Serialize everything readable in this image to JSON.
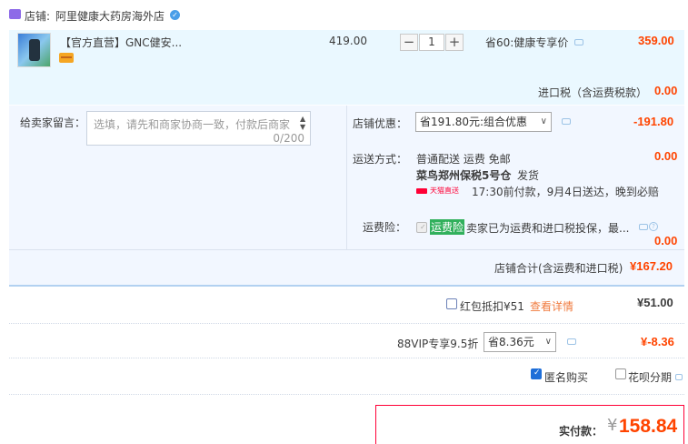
{
  "shop": {
    "prefix": "店铺:",
    "name": "阿里健康大药房海外店"
  },
  "item": {
    "title": "【官方直营】GNC健安...",
    "unit_price": "419.00",
    "quantity": "1",
    "qty_minus": "−",
    "qty_plus": "+",
    "promo": "省60:健康专享价",
    "subtotal": "359.00"
  },
  "tax": {
    "label": "进口税（含运费税款）",
    "value": "0.00"
  },
  "message": {
    "label": "给卖家留言：",
    "placeholder": "选填，请先和商家协商一致，付款后商家",
    "counter": "0/200"
  },
  "shop_discount": {
    "label": "店铺优惠：",
    "selected": "省191.80元:组合优惠",
    "value": "-191.80"
  },
  "shipping": {
    "label": "运送方式：",
    "method": "普通配送 运费 免邮",
    "warehouse": "菜鸟郑州保税5号仓",
    "ship_suffix": "发货",
    "badge": "天猫直送",
    "eta": "17:30前付款，9月4日送达，晚到必赔",
    "value": "0.00"
  },
  "insurance": {
    "label": "运费险：",
    "tag": "运费险",
    "desc": "卖家已为运费和进口税投保，最...",
    "value": "0.00"
  },
  "shop_total": {
    "label": "店铺合计(含运费和进口税)",
    "value": "¥167.20"
  },
  "red_packet": {
    "label": "红包抵扣¥51",
    "link": "查看详情",
    "value": "¥51.00"
  },
  "vip": {
    "label": "88VIP专享9.5折",
    "selected": "省8.36元",
    "value": "¥-8.36"
  },
  "anonymous": {
    "label": "匿名购买"
  },
  "huabei": {
    "label": "花呗分期"
  },
  "pay": {
    "label": "实付款：",
    "currency": "¥",
    "value": "158.84"
  },
  "colors": {
    "accent": "#ff4400",
    "panel": "#f2f7ff",
    "row": "#eaf8ff",
    "tmall": "#ff0036",
    "green": "#31b05c"
  }
}
